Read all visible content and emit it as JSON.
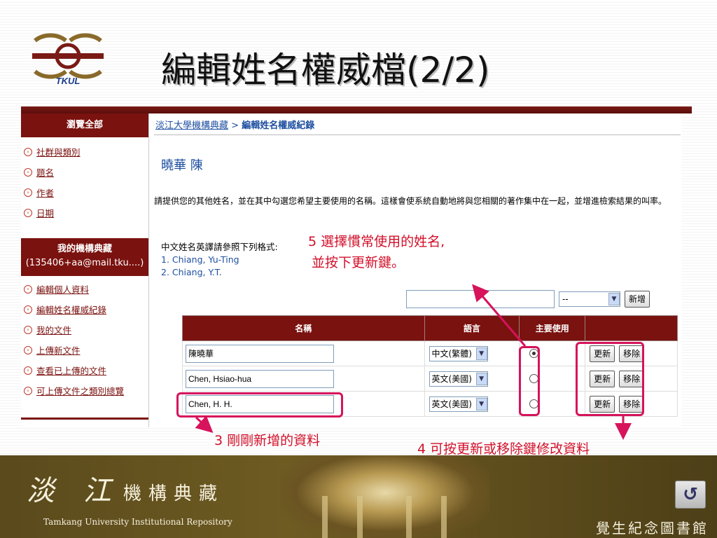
{
  "slide": {
    "title": "編輯姓名權威檔(2/2)",
    "logo_text": "TKUL"
  },
  "sidebar": {
    "browse_header": "瀏覽全部",
    "browse_items": [
      "社群與類別",
      "題名",
      "作者",
      "日期"
    ],
    "my_header": "我的機構典藏",
    "my_account": "(135406+aa@mail.tku....)",
    "my_items": [
      "編輯個人資料",
      "編輯姓名權威紀錄",
      "我的文件",
      "上傳新文件",
      "查看已上傳的文件",
      "可上傳文件之類別總覽"
    ]
  },
  "content": {
    "breadcrumb_link": "淡江大學機構典藏",
    "breadcrumb_sep": ">",
    "breadcrumb_current": "編輯姓名權威紀錄",
    "person_name": "曉華 陳",
    "description": "請提供您的其他姓名，並在其中勾選您希望主要使用的名稱。這樣會使系統自動地將與您相關的著作集中在一起，並增進檢索結果的叫率。",
    "format_intro": "中文姓名英譯請參照下列格式:",
    "format_ex1": "1. Chiang, Yu-Ting",
    "format_ex2": "2. Chiang, Y.T.",
    "new_select_value": "--",
    "add_button": "新增",
    "table_headers": {
      "name": "名稱",
      "lang": "語言",
      "primary": "主要使用"
    },
    "rows": [
      {
        "name": "陳曉華",
        "lang": "中文(繁體)",
        "primary": true
      },
      {
        "name": "Chen, Hsiao-hua",
        "lang": "英文(美國)",
        "primary": false
      },
      {
        "name": "Chen, H. H.",
        "lang": "英文(美國)",
        "primary": false
      }
    ],
    "update_button": "更新",
    "remove_button": "移除"
  },
  "annotations": {
    "step5_line1": "5 選擇慣常使用的姓名,",
    "step5_line2": "並按下更新鍵。",
    "step3": "3 剛剛新增的資料",
    "step4": "4 可按更新或移除鍵修改資料",
    "color": "#d2102a"
  },
  "footer": {
    "calligraphy_1": "淡 江",
    "calligraphy_2": "機構典藏",
    "english": "Tamkang University Institutional Repository",
    "library": "覺生紀念圖書館",
    "return_icon": "↺"
  }
}
